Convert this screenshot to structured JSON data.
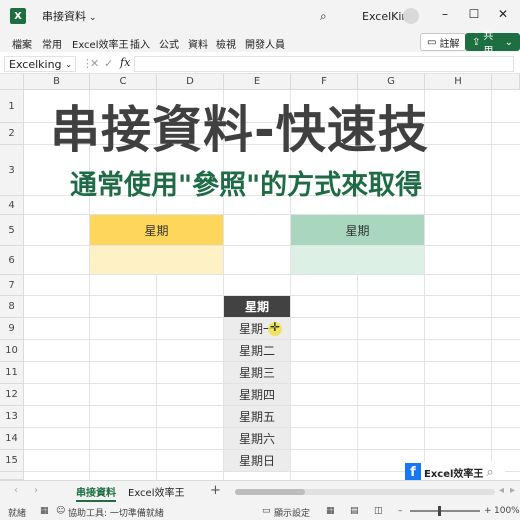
{
  "titlebar": {
    "app_icon": "X",
    "doc_name": "串接資料",
    "user": "ExcelKing",
    "icons": [
      "search-icon",
      "minimize-icon",
      "maximize-icon",
      "close-icon"
    ]
  },
  "ribbon": {
    "tabs": [
      "檔案",
      "常用",
      "Excel效率王",
      "插入",
      "公式",
      "資料",
      "檢視",
      "開發人員"
    ],
    "comment_label": "註解",
    "share_label": "共用"
  },
  "formula_bar": {
    "name_box": "Excelking",
    "fx": "fx",
    "formula": ""
  },
  "grid": {
    "columns": [
      "B",
      "C",
      "D",
      "E",
      "F",
      "G",
      "H"
    ],
    "rows": [
      "1",
      "2",
      "3",
      "4",
      "5",
      "6",
      "7",
      "8",
      "9",
      "10",
      "11",
      "12",
      "13",
      "14",
      "15"
    ],
    "title": "串接資料-快速技",
    "subtitle": "通常使用\"參照\"的方式來取得",
    "yellow_header": "星期",
    "green_header": "星期",
    "week_header": "星期",
    "week_items": [
      "星期一",
      "星期二",
      "星期三",
      "星期四",
      "星期五",
      "星期六",
      "星期日"
    ]
  },
  "brand_badge": {
    "text": "Excel效率王"
  },
  "sheet_tabs": {
    "tabs": [
      "串接資料",
      "Excel效率王"
    ],
    "active": "串接資料"
  },
  "status_bar": {
    "ready": "就緒",
    "accessibility": "協助工具: 一切準備就緒",
    "display_settings": "顯示設定",
    "zoom": "100%"
  },
  "colors": {
    "accent": "#1d6f42",
    "yellow_header": "#ffd65c",
    "green_header": "#a9d6bf",
    "week_header": "#424242"
  }
}
